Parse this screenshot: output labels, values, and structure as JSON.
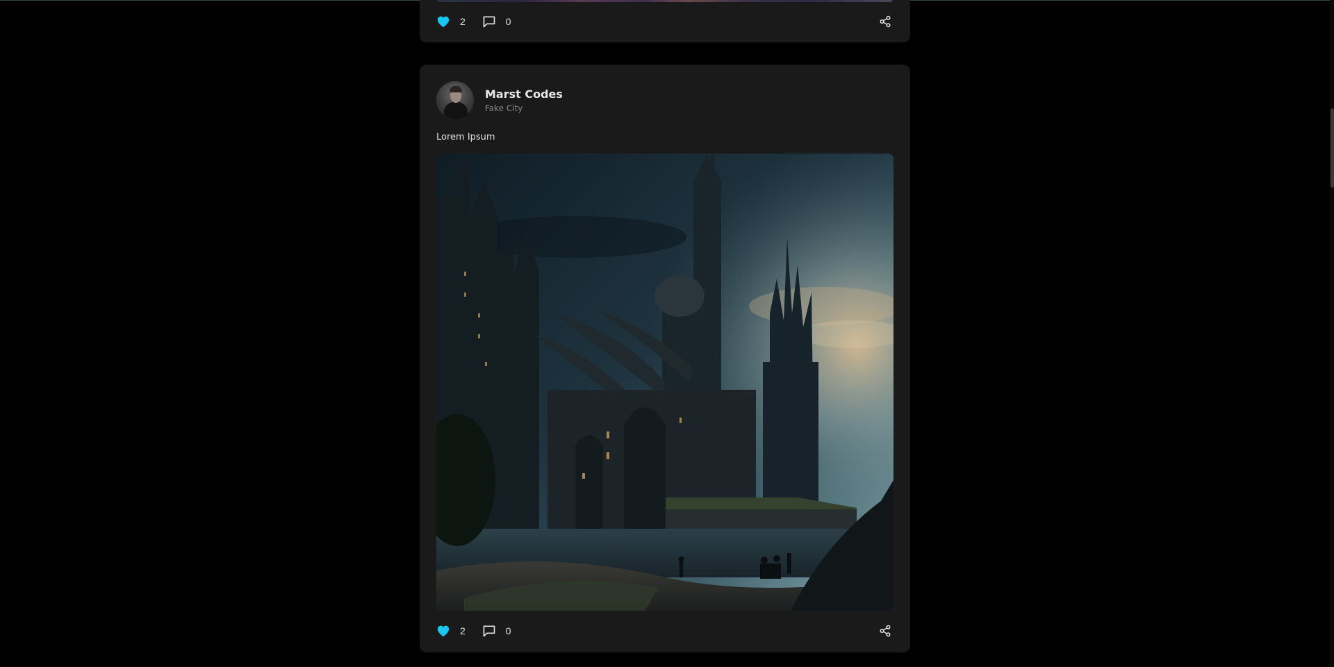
{
  "colors": {
    "background": "#000000",
    "card": "#1a1a1a",
    "like_accent": "#18c6ee",
    "text_primary": "#e8e8e8",
    "text_secondary": "#8a8a8a"
  },
  "posts": [
    {
      "likes": "2",
      "comments": "0",
      "like_icon": "heart-filled-icon",
      "comment_icon": "comment-icon",
      "share_icon": "share-icon"
    },
    {
      "user": {
        "name": "Marst Codes",
        "location": "Fake City",
        "avatar": "user-avatar"
      },
      "text": "Lorem Ipsum",
      "image": "fantasy-gothic-city-image",
      "likes": "2",
      "comments": "0",
      "like_icon": "heart-filled-icon",
      "comment_icon": "comment-icon",
      "share_icon": "share-icon"
    }
  ]
}
